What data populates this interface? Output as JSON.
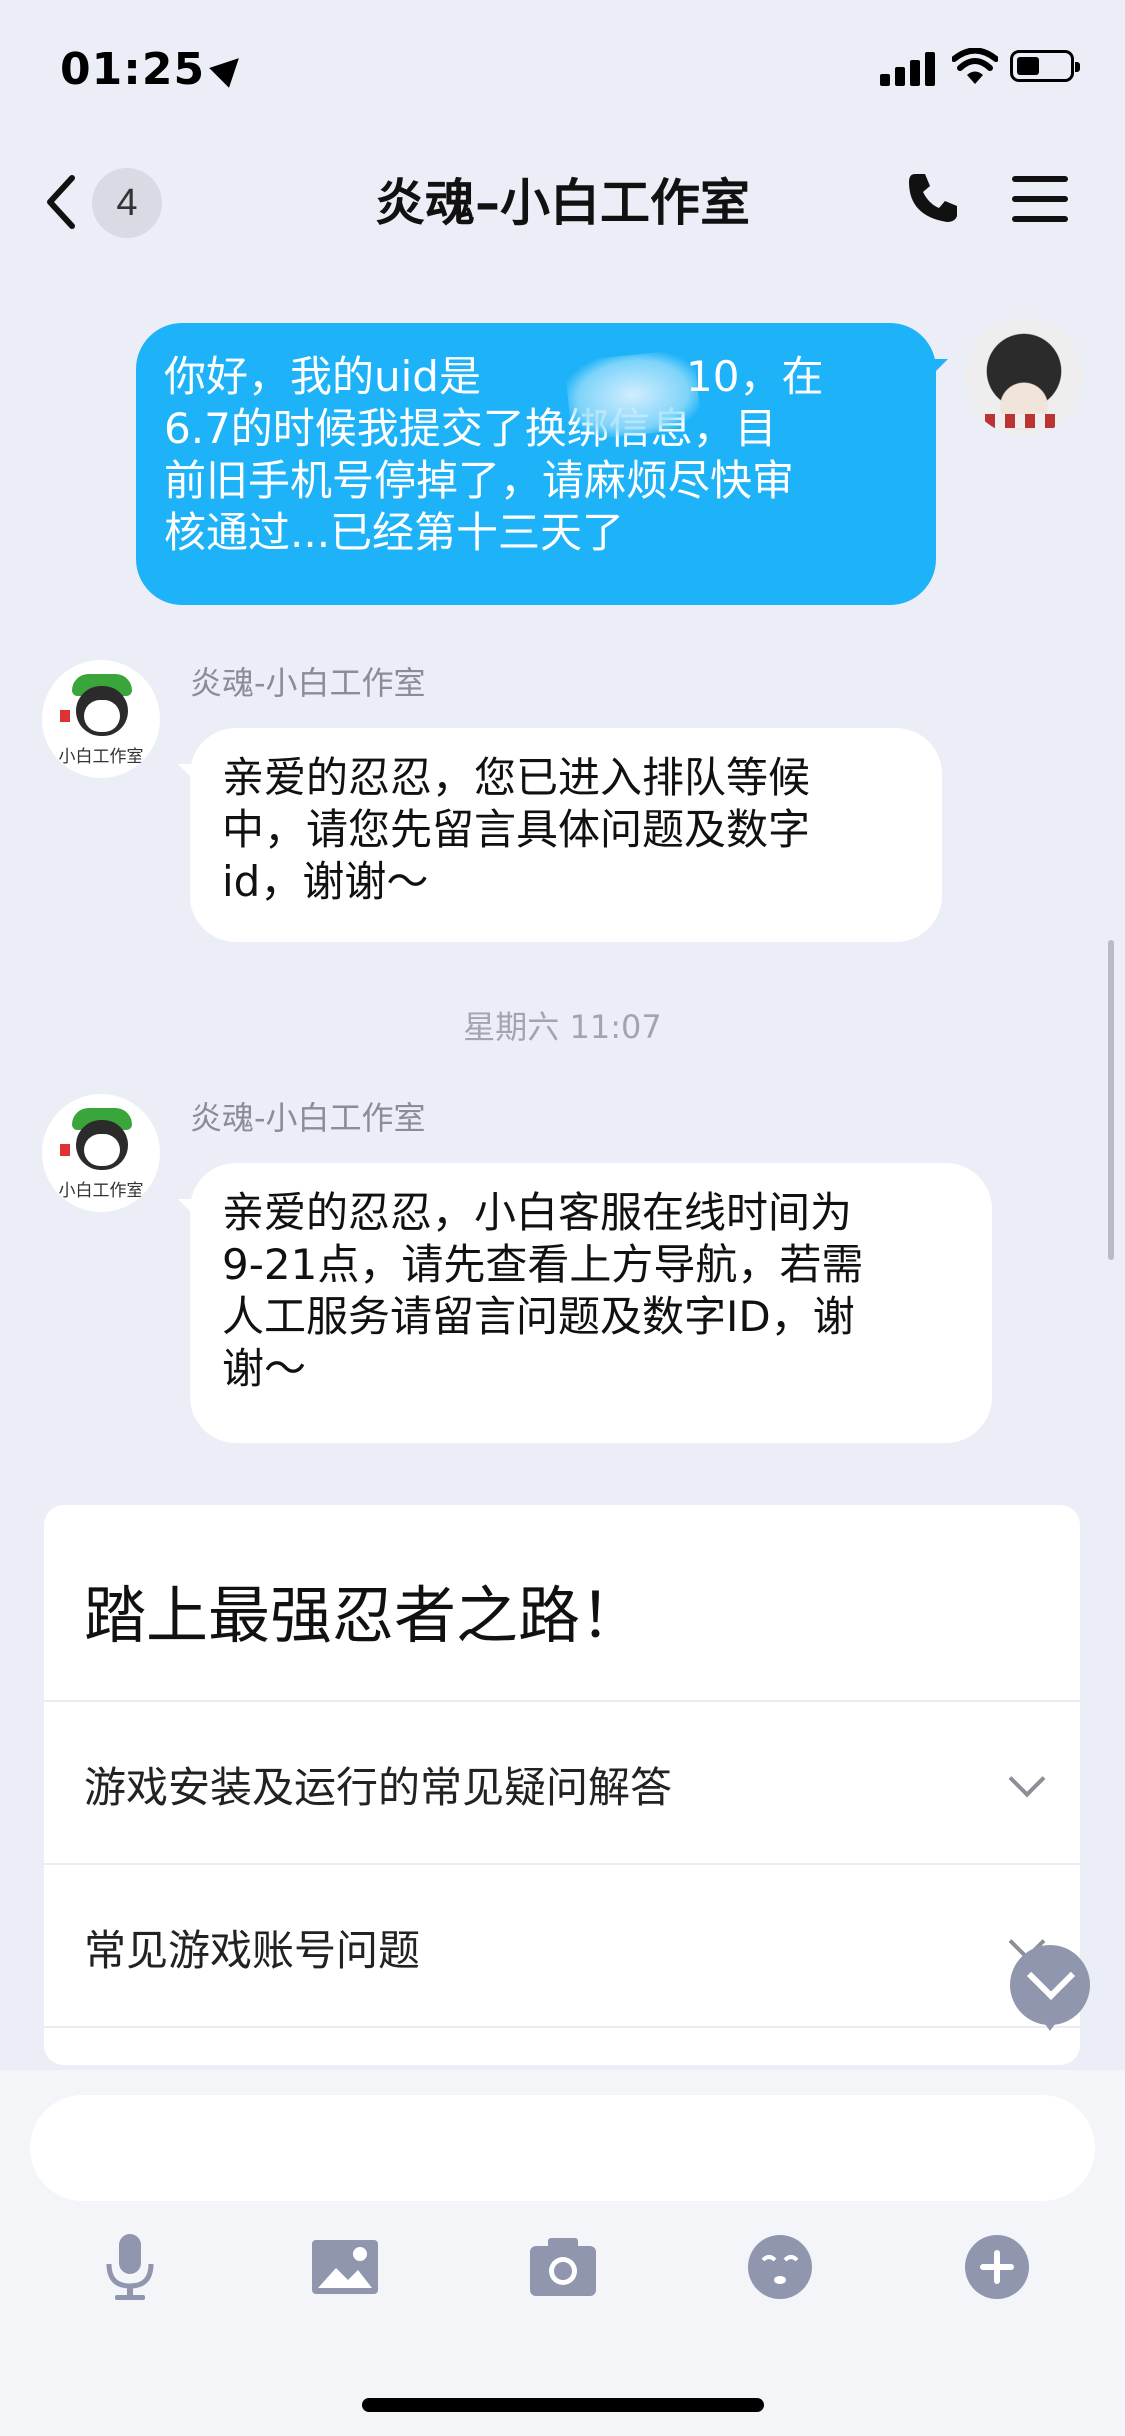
{
  "status_bar": {
    "time": "01:25"
  },
  "nav": {
    "badge_count": "4",
    "title": "炎魂–小白工作室"
  },
  "messages": {
    "outgoing": {
      "lines": [
        "你好，我的uid是",
        "6.7的时候我提交了换绑信息，目",
        "前旧手机号停掉了，请麻烦尽快审",
        "核通过...已经第十三天了"
      ],
      "line1_tail": "10，在"
    },
    "incoming_1": {
      "sender": "炎魂-小白工作室",
      "avatar_text": "小白工作室",
      "lines": [
        "亲爱的忍忍，您已进入排队等候",
        "中，请您先留言具体问题及数字",
        "id，谢谢～"
      ]
    },
    "timestamp": "星期六 11:07",
    "incoming_2": {
      "sender": "炎魂-小白工作室",
      "avatar_text": "小白工作室",
      "lines": [
        "亲爱的忍忍，小白客服在线时间为",
        "9-21点，请先查看上方导航，若需",
        "人工服务请留言问题及数字ID，谢",
        "谢～"
      ]
    }
  },
  "card": {
    "title": "踏上最强忍者之路！",
    "items": [
      {
        "label": "游戏安装及运行的常见疑问解答"
      },
      {
        "label": "常见游戏账号问题"
      }
    ]
  },
  "input": {
    "placeholder": ""
  },
  "toolbar": {
    "icons": [
      "microphone-icon",
      "image-icon",
      "camera-icon",
      "emoji-icon",
      "plus-icon"
    ]
  }
}
